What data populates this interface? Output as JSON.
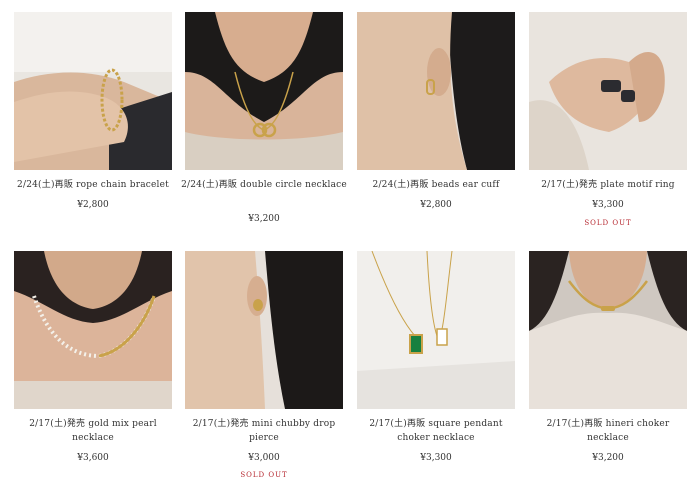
{
  "products": [
    {
      "name": "2/24(土)再販 rope chain bracelet",
      "price": "¥2,800",
      "status": "",
      "photo": "bracelet-photo"
    },
    {
      "name": "2/24(土)再販 double circle necklace",
      "price": "¥3,200",
      "status": "",
      "photo": "necklace-photo"
    },
    {
      "name": "2/24(土)再販 beads ear cuff",
      "price": "¥2,800",
      "status": "",
      "photo": "ear-cuff-photo"
    },
    {
      "name": "2/17(土)発売 plate motif ring",
      "price": "¥3,300",
      "status": "SOLD OUT",
      "photo": "ring-photo"
    },
    {
      "name": "2/17(土)発売 gold mix pearl necklace",
      "price": "¥3,600",
      "status": "",
      "photo": "pearl-necklace-photo"
    },
    {
      "name": "2/17(土)発売 mini chubby drop pierce",
      "price": "¥3,000",
      "status": "SOLD OUT",
      "photo": "pierce-photo"
    },
    {
      "name": "2/17(土)再販 square pendant choker necklace",
      "price": "¥3,300",
      "status": "",
      "photo": "pendant-photo"
    },
    {
      "name": "2/17(土)再販 hineri choker necklace",
      "price": "¥3,200",
      "status": "",
      "photo": "choker-photo"
    }
  ],
  "colors": {
    "sold_out": "#b5262e",
    "text": "#333333",
    "gold": "#c9a24a"
  }
}
